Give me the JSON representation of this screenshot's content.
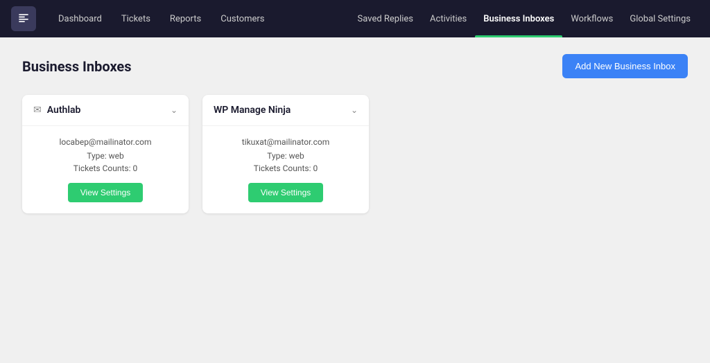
{
  "navbar": {
    "logo_alt": "App Logo",
    "nav_left": [
      {
        "label": "Dashboard",
        "key": "dashboard"
      },
      {
        "label": "Tickets",
        "key": "tickets"
      },
      {
        "label": "Reports",
        "key": "reports"
      },
      {
        "label": "Customers",
        "key": "customers"
      }
    ],
    "nav_right": [
      {
        "label": "Saved Replies",
        "key": "saved-replies",
        "active": false
      },
      {
        "label": "Activities",
        "key": "activities",
        "active": false
      },
      {
        "label": "Business Inboxes",
        "key": "business-inboxes",
        "active": true
      },
      {
        "label": "Workflows",
        "key": "workflows",
        "active": false
      },
      {
        "label": "Global Settings",
        "key": "global-settings",
        "active": false
      }
    ]
  },
  "page": {
    "title": "Business Inboxes",
    "add_button_label": "Add New Business Inbox"
  },
  "inboxes": [
    {
      "name": "Authlab",
      "email": "locabep@mailinator.com",
      "type": "Type: web",
      "tickets": "Tickets Counts: 0",
      "view_settings_label": "View Settings"
    },
    {
      "name": "WP Manage Ninja",
      "email": "tikuxat@mailinator.com",
      "type": "Type: web",
      "tickets": "Tickets Counts: 0",
      "view_settings_label": "View Settings"
    }
  ]
}
